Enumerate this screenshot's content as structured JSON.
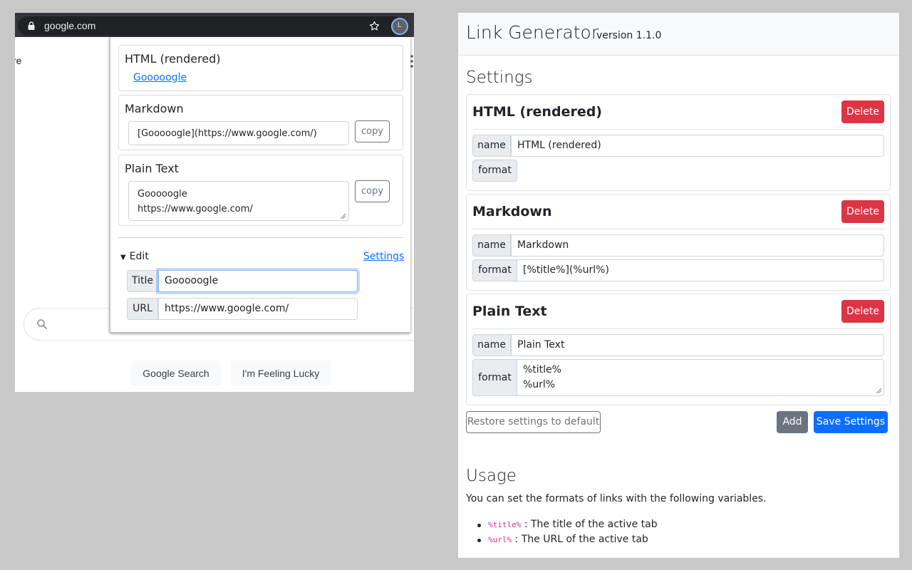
{
  "browser": {
    "url": "google.com",
    "extension_badge": "L",
    "page_fragment": "re",
    "google_search_button": "Google Search",
    "feeling_lucky_button": "I'm Feeling Lucky"
  },
  "popup": {
    "cards": [
      {
        "title": "HTML (rendered)",
        "link_text": "Gooooogle"
      },
      {
        "title": "Markdown",
        "output": "[Gooooogle](https://www.google.com/)",
        "copy_label": "copy"
      },
      {
        "title": "Plain Text",
        "output": "Gooooogle\nhttps://www.google.com/",
        "copy_label": "copy"
      }
    ],
    "edit_label": "Edit",
    "settings_link": "Settings",
    "title_label": "Title",
    "title_value": "Gooooogle",
    "url_label": "URL",
    "url_value": "https://www.google.com/"
  },
  "settings_page": {
    "app_title": "Link Generator",
    "version": "version 1.1.0",
    "heading": "Settings",
    "delete_label": "Delete",
    "name_label": "name",
    "format_label": "format",
    "formats": [
      {
        "title": "HTML (rendered)",
        "name": "HTML (rendered)",
        "format": ""
      },
      {
        "title": "Markdown",
        "name": "Markdown",
        "format": "[%title%](%url%)"
      },
      {
        "title": "Plain Text",
        "name": "Plain Text",
        "format": "%title%\n%url%"
      }
    ],
    "restore_label": "Restore settings to default",
    "add_label": "Add",
    "save_label": "Save Settings",
    "usage_heading": "Usage",
    "usage_description": "You can set the formats of links with the following variables.",
    "variables": [
      {
        "code": "%title%",
        "description": ": The title of the active tab"
      },
      {
        "code": "%url%",
        "description": ": The URL of the active tab"
      }
    ]
  },
  "colors": {
    "danger": "#dc3545",
    "primary": "#0d6efd",
    "secondary": "#6c757d",
    "code": "#d63384"
  }
}
